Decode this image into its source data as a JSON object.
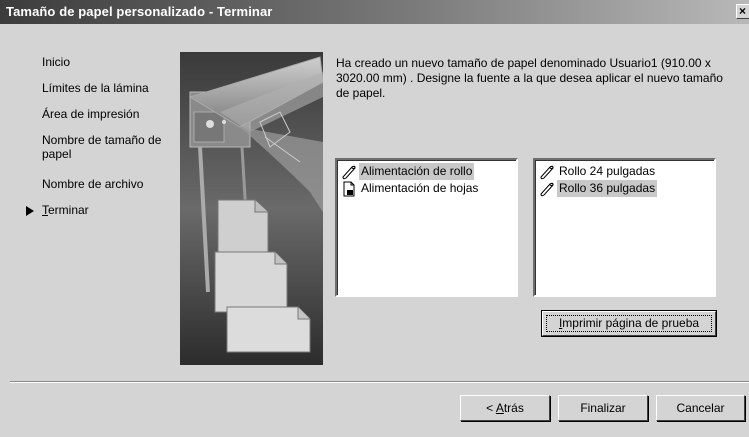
{
  "window": {
    "title": "Tamaño de papel personalizado - Terminar",
    "close_glyph": "×"
  },
  "steps": {
    "items": [
      {
        "label": "Inicio"
      },
      {
        "label": "Límites de la lámina"
      },
      {
        "label": "Área de impresión"
      },
      {
        "label": "Nombre de tamaño de papel"
      },
      {
        "label": "Nombre de archivo"
      },
      {
        "label_prefix": "",
        "label_accel": "T",
        "label_rest": "erminar",
        "current": true
      }
    ]
  },
  "message": "Ha creado un nuevo tamaño de papel denominado Usuario1 (910.00 x 3020.00 mm) . Designe la fuente a la que desea aplicar el nuevo tamaño de papel.",
  "source_list": {
    "items": [
      {
        "label": "Alimentación de rollo",
        "icon": "roll-icon",
        "selected": true
      },
      {
        "label": "Alimentación de hojas",
        "icon": "sheet-icon",
        "selected": false
      }
    ]
  },
  "roll_list": {
    "items": [
      {
        "label": "Rollo 24 pulgadas",
        "icon": "roll-icon",
        "selected": false
      },
      {
        "label": "Rollo 36 pulgadas",
        "icon": "roll-icon",
        "selected": true
      }
    ]
  },
  "buttons": {
    "print_test": "Imprimir página de prueba",
    "print_test_accel": "I",
    "print_test_rest": "mprimir página de prueba",
    "back_prefix": "< ",
    "back_accel": "A",
    "back_rest": "trás",
    "finish": "Finalizar",
    "cancel": "Cancelar"
  },
  "colors": {
    "face": "#d4d4d4",
    "selection": "#c8c8c8"
  }
}
